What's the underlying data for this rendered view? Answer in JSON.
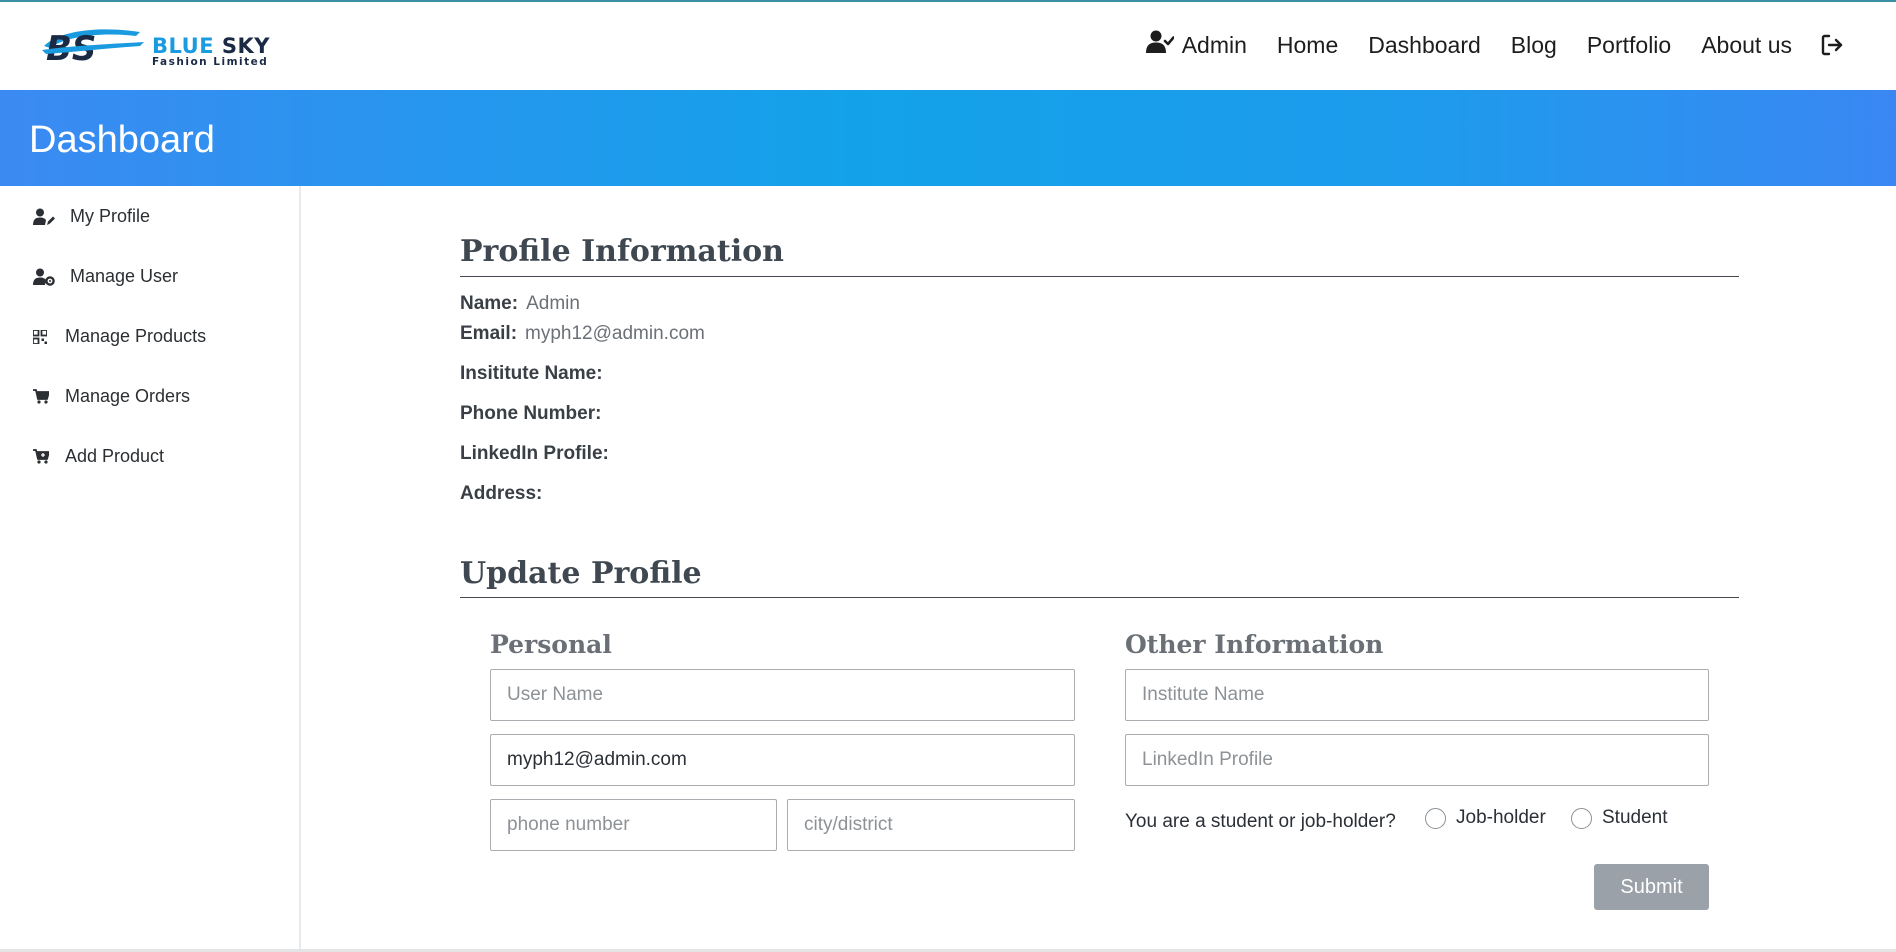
{
  "brand": {
    "mark": "BS",
    "title_part1": "BLUE ",
    "title_part2": "SKY",
    "subtitle": "Fashion Limited"
  },
  "nav": {
    "user_label": "Admin",
    "links": [
      "Home",
      "Dashboard",
      "Blog",
      "Portfolio",
      "About us"
    ],
    "logout_icon": "sign-out-icon"
  },
  "banner": {
    "title": "Dashboard"
  },
  "sidebar": {
    "items": [
      {
        "label": "My Profile",
        "icon": "user-edit-icon"
      },
      {
        "label": "Manage User",
        "icon": "user-cog-icon"
      },
      {
        "label": "Manage Products",
        "icon": "qrcode-grid-icon"
      },
      {
        "label": "Manage Orders",
        "icon": "cart-icon"
      },
      {
        "label": "Add Product",
        "icon": "cart-plus-icon"
      }
    ]
  },
  "profile": {
    "heading": "Profile Information",
    "name_label": "Name:",
    "name_value": "Admin",
    "email_label": "Email:",
    "email_value": "myph12@admin.com",
    "institute_label": "Insititute Name:",
    "phone_label": "Phone Number:",
    "linkedin_label": "LinkedIn Profile:",
    "address_label": "Address:"
  },
  "update": {
    "heading": "Update Profile",
    "personal_heading": "Personal",
    "other_heading": "Other Information",
    "username_placeholder": "User Name",
    "email_value": "myph12@admin.com",
    "phone_placeholder": "phone number",
    "city_placeholder": "city/district",
    "institute_placeholder": "Institute Name",
    "linkedin_placeholder": "LinkedIn Profile",
    "question": "You are a student or job-holder?",
    "option_jobholder": "Job-holder",
    "option_student": "Student",
    "submit_label": "Submit"
  },
  "colors": {
    "banner_gradient": [
      "#3b8af2",
      "#13a2ea",
      "#3a87f3"
    ],
    "brand_blue": "#1a9be0",
    "brand_dark": "#1b2a44",
    "submit_bg": "#9aa1a8"
  }
}
